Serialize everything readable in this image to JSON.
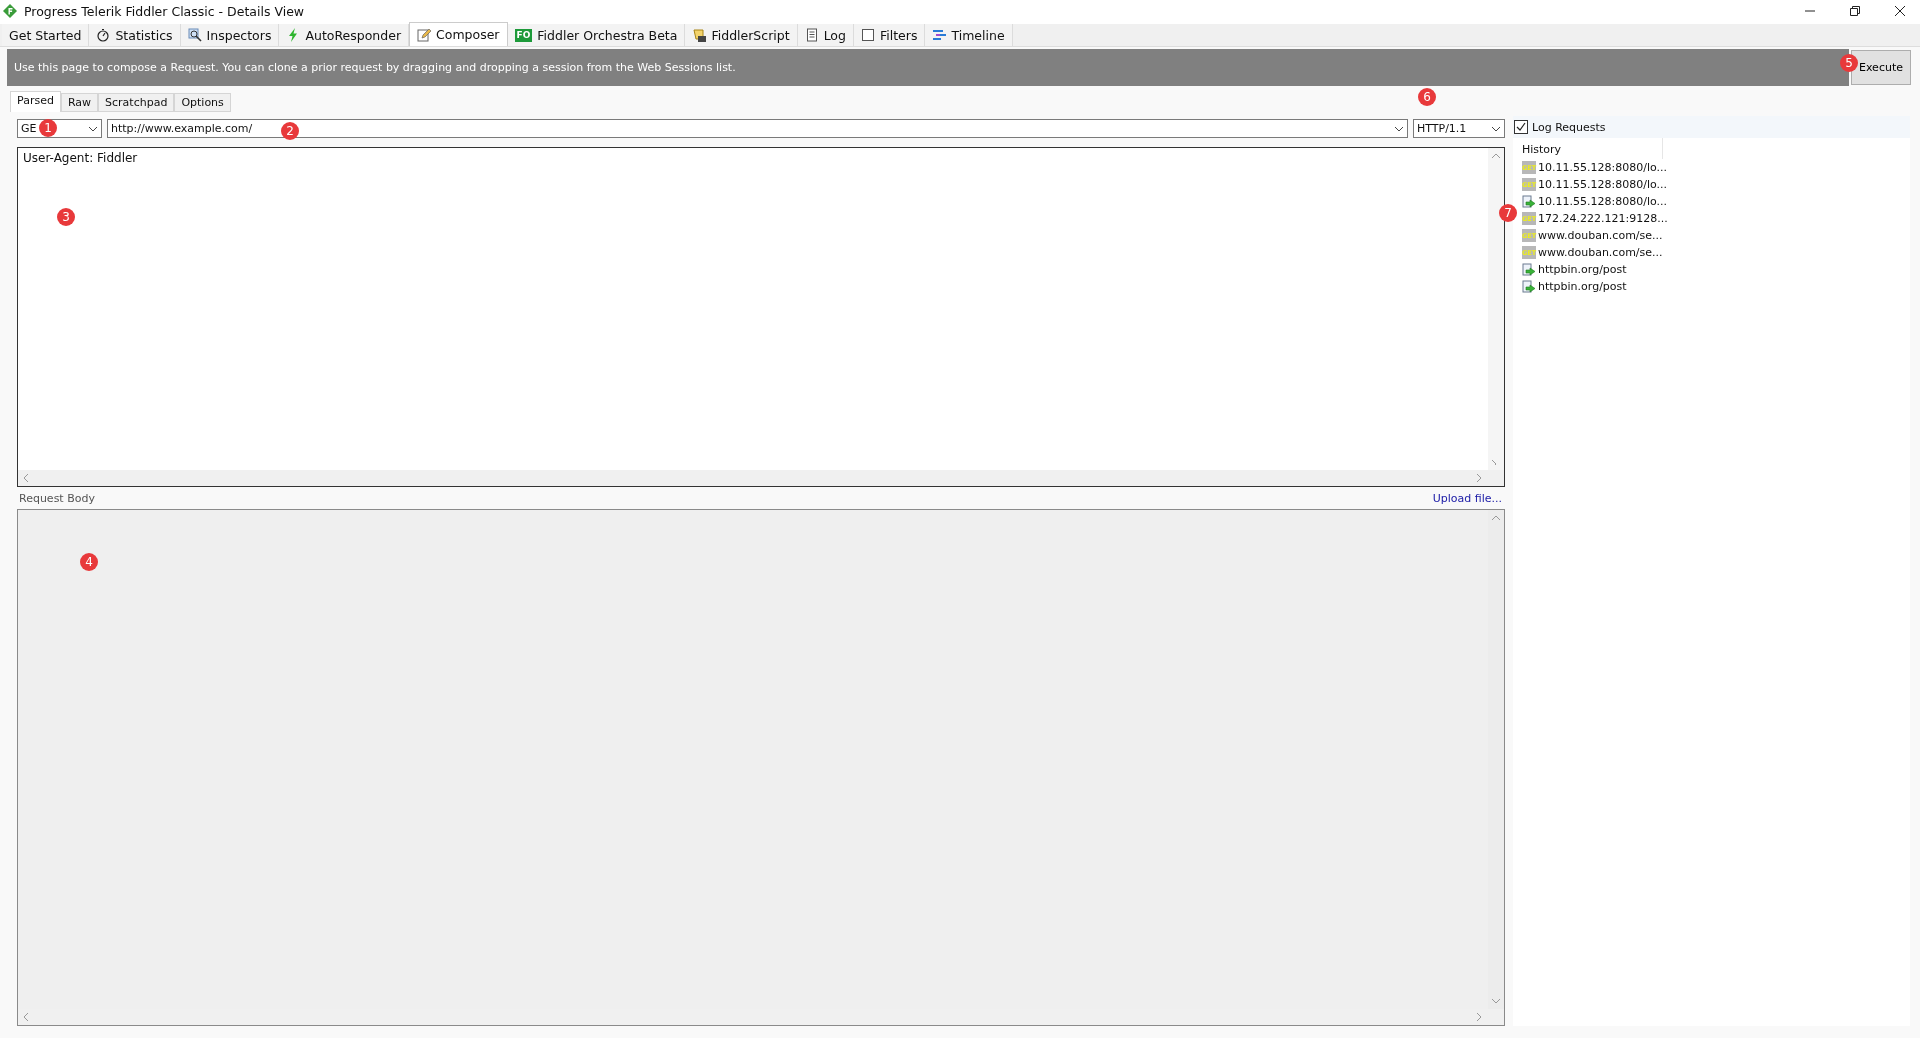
{
  "window": {
    "title": "Progress Telerik Fiddler Classic - Details View"
  },
  "tabs": [
    {
      "label": "Get Started",
      "selected": false
    },
    {
      "label": "Statistics",
      "selected": false
    },
    {
      "label": "Inspectors",
      "selected": false
    },
    {
      "label": "AutoResponder",
      "selected": false
    },
    {
      "label": "Composer",
      "selected": true
    },
    {
      "label": "Fiddler Orchestra Beta",
      "icon_text": "FO",
      "selected": false
    },
    {
      "label": "FiddlerScript",
      "selected": false
    },
    {
      "label": "Log",
      "selected": false
    },
    {
      "label": "Filters",
      "selected": false
    },
    {
      "label": "Timeline",
      "selected": false
    }
  ],
  "info_bar": {
    "text": "Use this page to compose a Request. You can clone a prior request by dragging and dropping a session from the Web Sessions list.",
    "button": "Execute"
  },
  "subtabs": [
    {
      "label": "Parsed",
      "selected": true
    },
    {
      "label": "Raw",
      "selected": false
    },
    {
      "label": "Scratchpad",
      "selected": false
    },
    {
      "label": "Options",
      "selected": false
    }
  ],
  "method": "GE",
  "url": "http://www.example.com/",
  "version": "HTTP/1.1",
  "headers": "User-Agent: Fiddler",
  "body_label": "Request Body",
  "upload_link": "Upload file...",
  "log_requests": {
    "label": "Log Requests",
    "checked": true
  },
  "history": {
    "heading": "History",
    "items": [
      {
        "kind": "get",
        "icon_text": "GET",
        "text": "10.11.55.128:8080/lo..."
      },
      {
        "kind": "get",
        "icon_text": "GET",
        "text": "10.11.55.128:8080/lo..."
      },
      {
        "kind": "post",
        "text": "10.11.55.128:8080/lo..."
      },
      {
        "kind": "get",
        "icon_text": "GET",
        "text": "172.24.222.121:9128..."
      },
      {
        "kind": "get",
        "icon_text": "GET",
        "text": "www.douban.com/se..."
      },
      {
        "kind": "get",
        "icon_text": "GET",
        "text": "www.douban.com/se..."
      },
      {
        "kind": "post",
        "text": "httpbin.org/post"
      },
      {
        "kind": "post",
        "text": "httpbin.org/post"
      }
    ]
  },
  "annotations": [
    {
      "label": "1"
    },
    {
      "label": "2"
    },
    {
      "label": "3"
    },
    {
      "label": "4"
    },
    {
      "label": "5"
    },
    {
      "label": "6"
    },
    {
      "label": "7"
    }
  ]
}
